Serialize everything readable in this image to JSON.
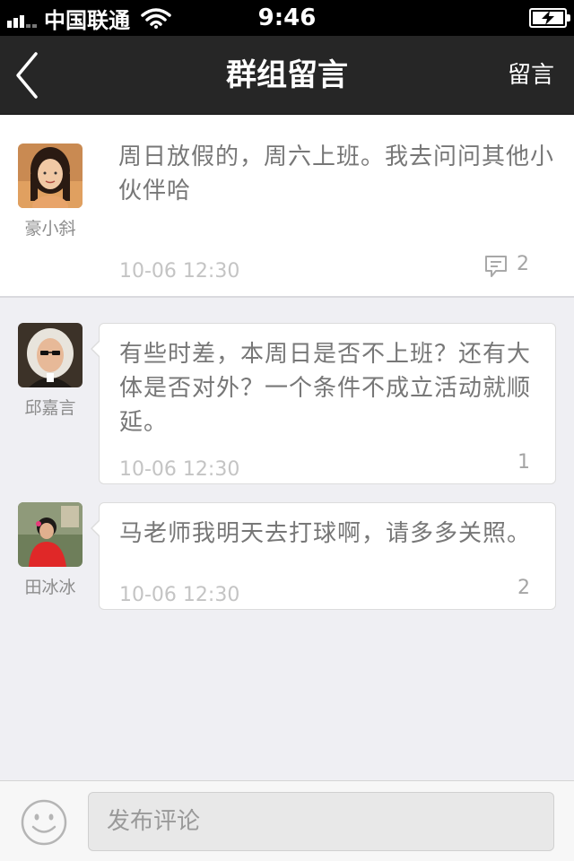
{
  "status_bar": {
    "carrier": "中国联通",
    "time": "9:46",
    "icons": [
      "signal-icon",
      "wifi-icon",
      "battery-charging-icon"
    ]
  },
  "nav": {
    "title": "群组留言",
    "action_label": "留言",
    "back_icon": "chevron-left-icon"
  },
  "messages": [
    {
      "author": "豪小斜",
      "text": "周日放假的，周六上班。我去问问其他小伙伴哈",
      "time": "10-06 12:30",
      "count": "2",
      "show_comment_icon": true
    },
    {
      "author": "邱嘉言",
      "text": "有些时差，本周日是否不上班？还有大体是否对外？一个条件不成立活动就顺延。",
      "time": "10-06 12:30",
      "count": "1"
    },
    {
      "author": "田冰冰",
      "text": "马老师我明天去打球啊，请多多关照。",
      "time": "10-06 12:30",
      "count": "2"
    }
  ],
  "composer": {
    "placeholder": "发布评论",
    "emoji_icon": "smiley-icon"
  },
  "colors": {
    "nav_background": "#262626",
    "page_background": "#efeff3",
    "text": "#777777",
    "timestamp": "#c4c4c4"
  }
}
